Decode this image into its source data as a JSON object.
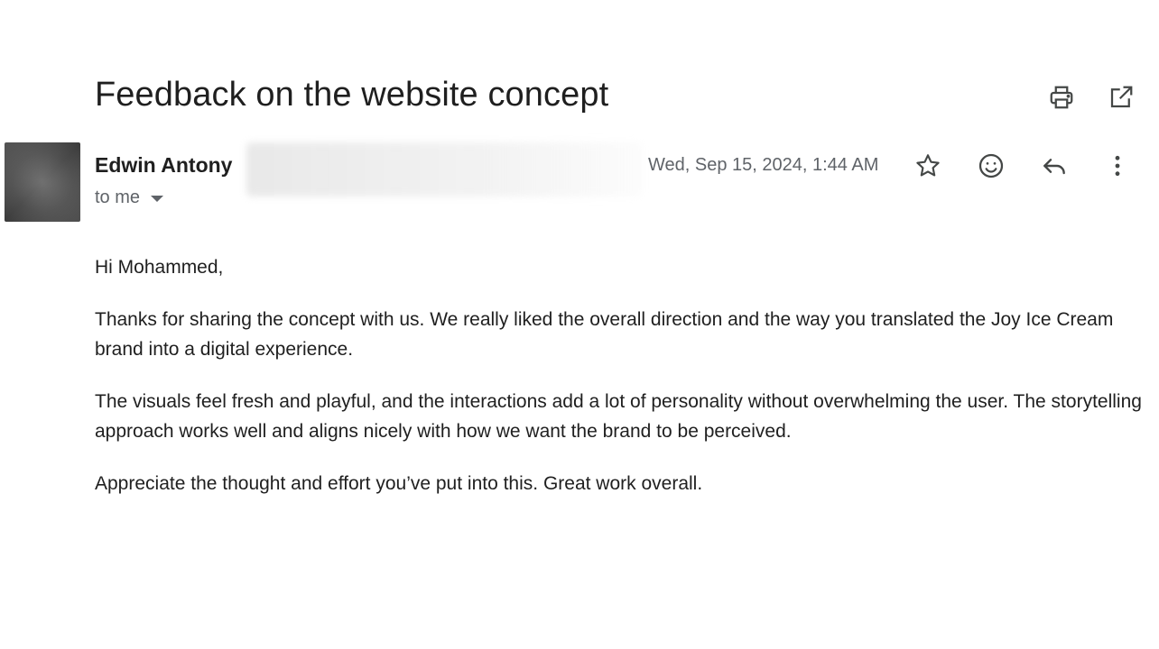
{
  "email": {
    "subject": "Feedback on the website concept",
    "sender_name": "Edwin Antony",
    "recipient_label": "to me",
    "date": "Wed, Sep 15, 2024, 1:44 AM",
    "greeting": "Hi Mohammed,",
    "paragraphs": [
      "Thanks for sharing the concept with us. We really liked the overall direction and the way you translated the Joy Ice Cream brand into a digital experience.",
      "The visuals feel fresh and playful, and the interactions add a lot of personality without overwhelming the user. The storytelling approach works well and aligns nicely with how we want the brand to be perceived.",
      "Appreciate the thought and effort you’ve put into this. Great work overall."
    ]
  },
  "icons": {
    "top": [
      "print-icon",
      "open-in-new-window-icon"
    ],
    "message": [
      "star-icon",
      "emoji-reaction-icon",
      "reply-icon",
      "more-vert-icon"
    ],
    "recipient_caret": "caret-down-icon"
  },
  "colors": {
    "text_primary": "#1f1f1f",
    "text_secondary": "#5f6368",
    "icon": "#444746",
    "background": "#ffffff"
  }
}
